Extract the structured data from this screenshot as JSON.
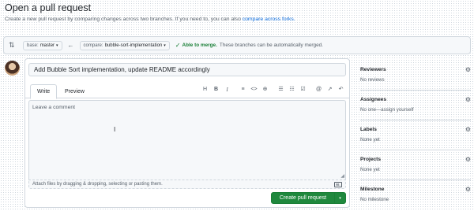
{
  "header": {
    "title": "Open a pull request",
    "subtitle_text": "Create a new pull request by comparing changes across two branches. If you need to, you can also",
    "subtitle_link": "compare across forks."
  },
  "compare": {
    "swap_icon": "git-compare-icon",
    "base_key": "base:",
    "base_value": "master",
    "arrow_icon": "arrow-left-icon",
    "compare_key": "compare:",
    "compare_value": "bubble-sort-implementation",
    "check_icon": "check-icon",
    "status_strong": "Able to merge.",
    "status_rest": "These branches can be automatically merged."
  },
  "editor": {
    "title_value": "Add Bubble Sort implementation, update README accordingly",
    "tabs": [
      "Write",
      "Preview"
    ],
    "toolbar": {
      "heading": "H",
      "bold": "B",
      "italic": "I",
      "quote": "≡",
      "code": "<>",
      "link": "⊕",
      "unordered_list": "☰",
      "ordered_list": "☷",
      "task_list": "☑",
      "mention": "@",
      "reference": "↗",
      "reply": "↶"
    },
    "comment_placeholder": "Leave a comment",
    "attach_text": "Attach files by dragging & dropping, selecting or pasting them.",
    "markdown_badge": "M↓",
    "create_button": "Create pull request",
    "create_caret": "▾"
  },
  "sidebar": {
    "gear_icon": "gear-icon",
    "reviewers_label": "Reviewers",
    "reviewers_value": "No reviews",
    "assignees_label": "Assignees",
    "assignees_value": "No one—assign yourself",
    "labels_label": "Labels",
    "labels_value": "None yet",
    "projects_label": "Projects",
    "projects_value": "None yet",
    "milestone_label": "Milestone",
    "milestone_value": "No milestone"
  },
  "colors": {
    "accent_link": "#0969da",
    "success": "#1a7f37",
    "primary_button": "#1f883d",
    "border": "#d0d7de",
    "muted_text": "#57606a"
  }
}
